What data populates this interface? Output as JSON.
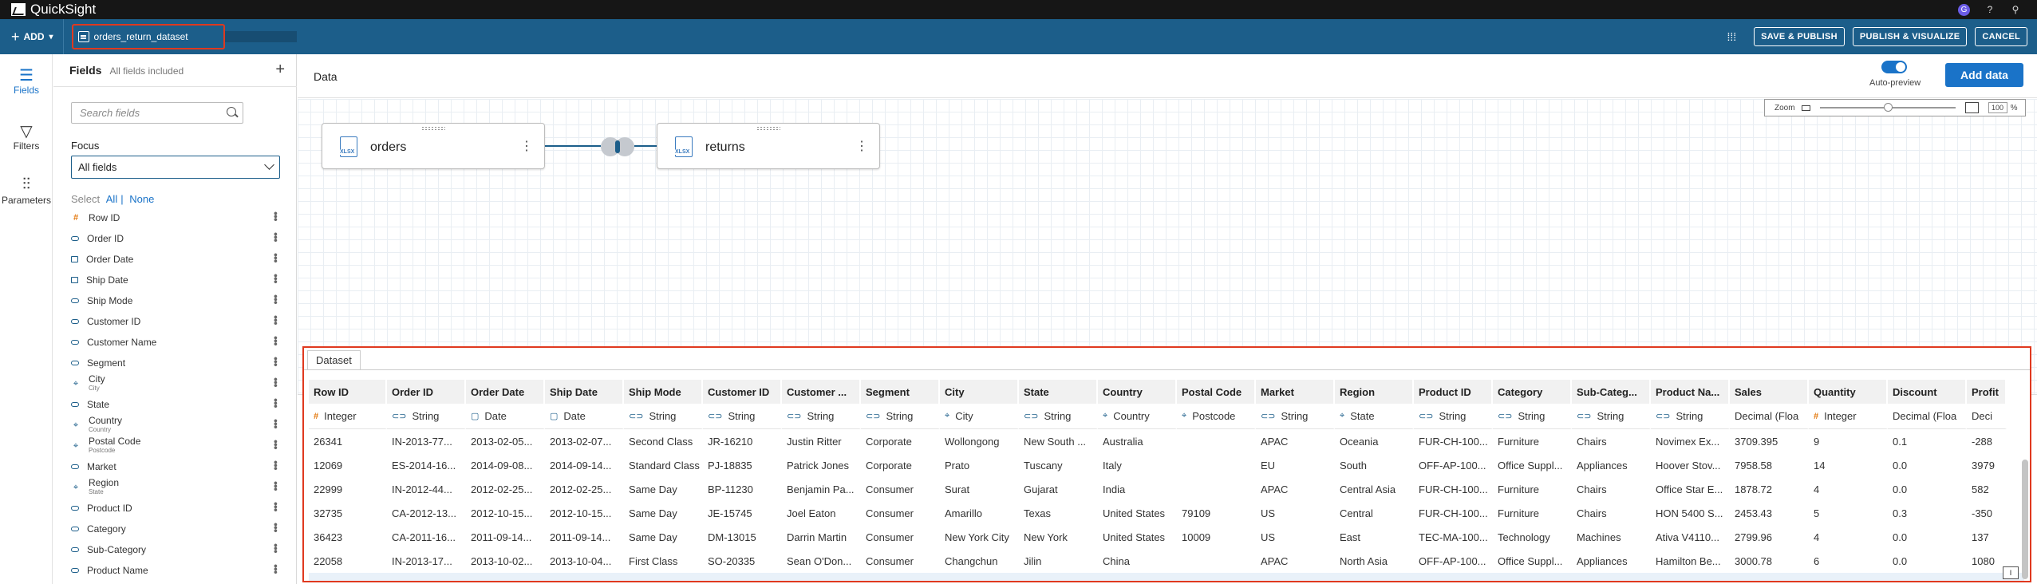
{
  "app": {
    "name": "QuickSight"
  },
  "toolbar": {
    "add_label": "ADD",
    "dataset_name": "orders_return_dataset",
    "save_publish": "SAVE & PUBLISH",
    "publish_visualize": "PUBLISH & VISUALIZE",
    "cancel": "CANCEL"
  },
  "rail": [
    {
      "label": "Fields",
      "icon": "database-icon",
      "active": true
    },
    {
      "label": "Filters",
      "icon": "filter-icon",
      "active": false
    },
    {
      "label": "Parameters",
      "icon": "sliders-icon",
      "active": false
    }
  ],
  "fields_panel": {
    "title": "Fields",
    "subtitle": "All fields included",
    "search_placeholder": "Search fields",
    "focus_label": "Focus",
    "focus_value": "All fields",
    "select_label": "Select",
    "select_all": "All",
    "select_none": "None",
    "items": [
      {
        "name": "Row ID",
        "type": "num"
      },
      {
        "name": "Order ID",
        "type": "str"
      },
      {
        "name": "Order Date",
        "type": "date"
      },
      {
        "name": "Ship Date",
        "type": "date"
      },
      {
        "name": "Ship Mode",
        "type": "str"
      },
      {
        "name": "Customer ID",
        "type": "str"
      },
      {
        "name": "Customer Name",
        "type": "str"
      },
      {
        "name": "Segment",
        "type": "str"
      },
      {
        "name": "City",
        "type": "geo",
        "sub": "City"
      },
      {
        "name": "State",
        "type": "str"
      },
      {
        "name": "Country",
        "type": "geo",
        "sub": "Country"
      },
      {
        "name": "Postal Code",
        "type": "geo",
        "sub": "Postcode"
      },
      {
        "name": "Market",
        "type": "str"
      },
      {
        "name": "Region",
        "type": "geo",
        "sub": "State"
      },
      {
        "name": "Product ID",
        "type": "str"
      },
      {
        "name": "Category",
        "type": "str"
      },
      {
        "name": "Sub-Category",
        "type": "str"
      },
      {
        "name": "Product Name",
        "type": "str"
      }
    ]
  },
  "data_header": {
    "title": "Data",
    "auto_preview": "Auto-preview",
    "add_data": "Add data"
  },
  "zoom": {
    "label": "Zoom",
    "value": "100",
    "unit": "%",
    "level_fraction": 0.5
  },
  "nodes": [
    {
      "name": "orders"
    },
    {
      "name": "returns"
    }
  ],
  "preview": {
    "tab": "Dataset",
    "columns": [
      {
        "h": "Row ID",
        "t": "Integer",
        "ti": "#",
        "w": 98,
        "num": true
      },
      {
        "h": "Order ID",
        "t": "String",
        "ti": "⊂⊃",
        "w": 99
      },
      {
        "h": "Order Date",
        "t": "Date",
        "ti": "▢",
        "w": 99
      },
      {
        "h": "Ship Date",
        "t": "Date",
        "ti": "▢",
        "w": 99
      },
      {
        "h": "Ship Mode",
        "t": "String",
        "ti": "⊂⊃",
        "w": 99
      },
      {
        "h": "Customer ID",
        "t": "String",
        "ti": "⊂⊃",
        "w": 99
      },
      {
        "h": "Customer ...",
        "t": "String",
        "ti": "⊂⊃",
        "w": 99
      },
      {
        "h": "Segment",
        "t": "String",
        "ti": "⊂⊃",
        "w": 99
      },
      {
        "h": "City",
        "t": "City",
        "ti": "⌖",
        "w": 99
      },
      {
        "h": "State",
        "t": "String",
        "ti": "⊂⊃",
        "w": 99
      },
      {
        "h": "Country",
        "t": "Country",
        "ti": "⌖",
        "w": 99
      },
      {
        "h": "Postal Code",
        "t": "Postcode",
        "ti": "⌖",
        "w": 99
      },
      {
        "h": "Market",
        "t": "String",
        "ti": "⊂⊃",
        "w": 99
      },
      {
        "h": "Region",
        "t": "State",
        "ti": "⌖",
        "w": 99
      },
      {
        "h": "Product ID",
        "t": "String",
        "ti": "⊂⊃",
        "w": 99
      },
      {
        "h": "Category",
        "t": "String",
        "ti": "⊂⊃",
        "w": 99
      },
      {
        "h": "Sub-Categ...",
        "t": "String",
        "ti": "⊂⊃",
        "w": 99
      },
      {
        "h": "Product Na...",
        "t": "String",
        "ti": "⊂⊃",
        "w": 99
      },
      {
        "h": "Sales",
        "t": "Decimal (Floa",
        "ti": "",
        "w": 99
      },
      {
        "h": "Quantity",
        "t": "Integer",
        "ti": "#",
        "w": 99,
        "num": true
      },
      {
        "h": "Discount",
        "t": "Decimal (Floa",
        "ti": "",
        "w": 99
      },
      {
        "h": "Profit",
        "t": "Deci",
        "ti": "",
        "w": 50
      }
    ],
    "rows": [
      [
        "26341",
        "IN-2013-77...",
        "2013-02-05...",
        "2013-02-07...",
        "Second Class",
        "JR-16210",
        "Justin Ritter",
        "Corporate",
        "Wollongong",
        "New South ...",
        "Australia",
        "",
        "APAC",
        "Oceania",
        "FUR-CH-100...",
        "Furniture",
        "Chairs",
        "Novimex Ex...",
        "3709.395",
        "9",
        "0.1",
        "-288"
      ],
      [
        "12069",
        "ES-2014-16...",
        "2014-09-08...",
        "2014-09-14...",
        "Standard Class",
        "PJ-18835",
        "Patrick Jones",
        "Corporate",
        "Prato",
        "Tuscany",
        "Italy",
        "",
        "EU",
        "South",
        "OFF-AP-100...",
        "Office Suppl...",
        "Appliances",
        "Hoover Stov...",
        "7958.58",
        "14",
        "0.0",
        "3979"
      ],
      [
        "22999",
        "IN-2012-44...",
        "2012-02-25...",
        "2012-02-25...",
        "Same Day",
        "BP-11230",
        "Benjamin Pa...",
        "Consumer",
        "Surat",
        "Gujarat",
        "India",
        "",
        "APAC",
        "Central Asia",
        "FUR-CH-100...",
        "Furniture",
        "Chairs",
        "Office Star E...",
        "1878.72",
        "4",
        "0.0",
        "582"
      ],
      [
        "32735",
        "CA-2012-13...",
        "2012-10-15...",
        "2012-10-15...",
        "Same Day",
        "JE-15745",
        "Joel Eaton",
        "Consumer",
        "Amarillo",
        "Texas",
        "United States",
        "79109",
        "US",
        "Central",
        "FUR-CH-100...",
        "Furniture",
        "Chairs",
        "HON 5400 S...",
        "2453.43",
        "5",
        "0.3",
        "-350"
      ],
      [
        "36423",
        "CA-2011-16...",
        "2011-09-14...",
        "2011-09-14...",
        "Same Day",
        "DM-13015",
        "Darrin Martin",
        "Consumer",
        "New York City",
        "New York",
        "United States",
        "10009",
        "US",
        "East",
        "TEC-MA-100...",
        "Technology",
        "Machines",
        "Ativa V4110...",
        "2799.96",
        "4",
        "0.0",
        "137"
      ],
      [
        "22058",
        "IN-2013-17...",
        "2013-10-02...",
        "2013-10-04...",
        "First Class",
        "SO-20335",
        "Sean O'Don...",
        "Consumer",
        "Changchun",
        "Jilin",
        "China",
        "",
        "APAC",
        "North Asia",
        "OFF-AP-100...",
        "Office Suppl...",
        "Appliances",
        "Hamilton Be...",
        "3000.78",
        "6",
        "0.0",
        "1080"
      ]
    ]
  }
}
